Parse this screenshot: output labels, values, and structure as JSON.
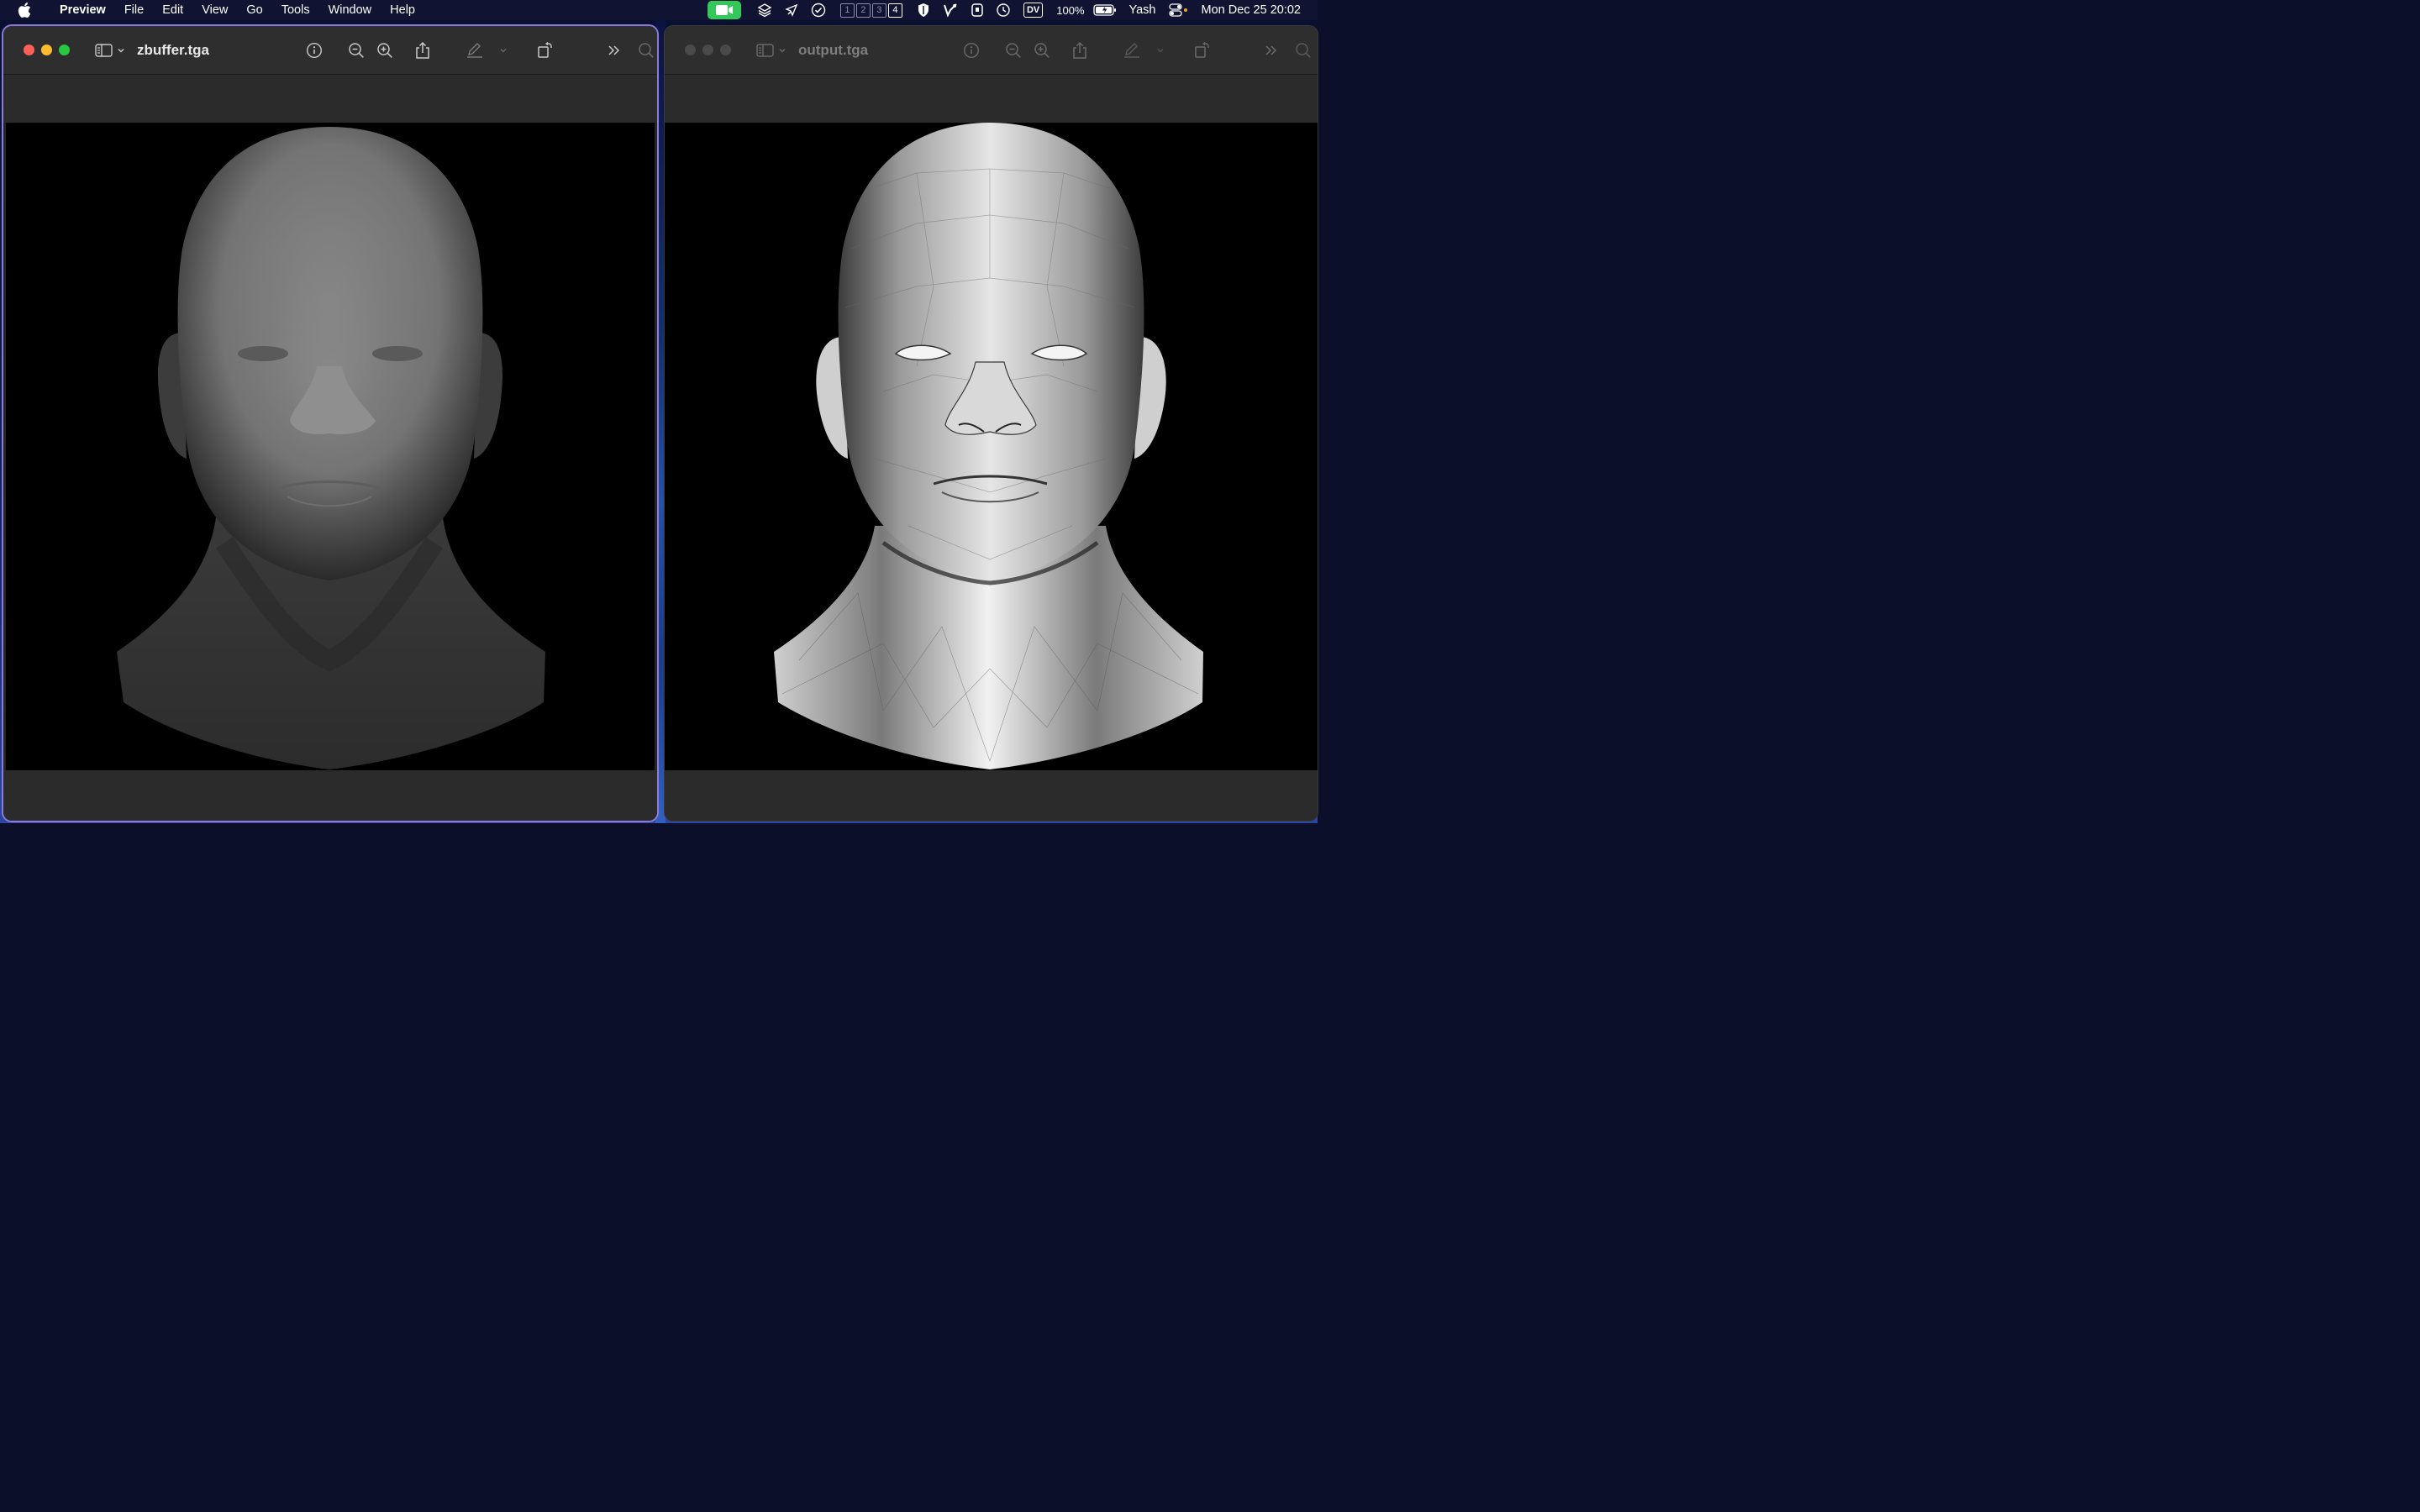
{
  "menubar": {
    "app_name": "Preview",
    "items": [
      "File",
      "Edit",
      "View",
      "Go",
      "Tools",
      "Window",
      "Help"
    ],
    "spaces": [
      "1",
      "2",
      "3",
      "4"
    ],
    "active_space": "4",
    "dv_label": "DV",
    "battery": "100%",
    "user": "Yash",
    "clock": "Mon Dec 25  20:02"
  },
  "windows": [
    {
      "title": "zbuffer.tga",
      "active": true
    },
    {
      "title": "output.tga",
      "active": false
    }
  ],
  "colors": {
    "active_border": "#8a7cd8",
    "facetime_green": "#34c759",
    "close": "#fe5f57",
    "minimize": "#febc2e",
    "zoom": "#28c840"
  }
}
